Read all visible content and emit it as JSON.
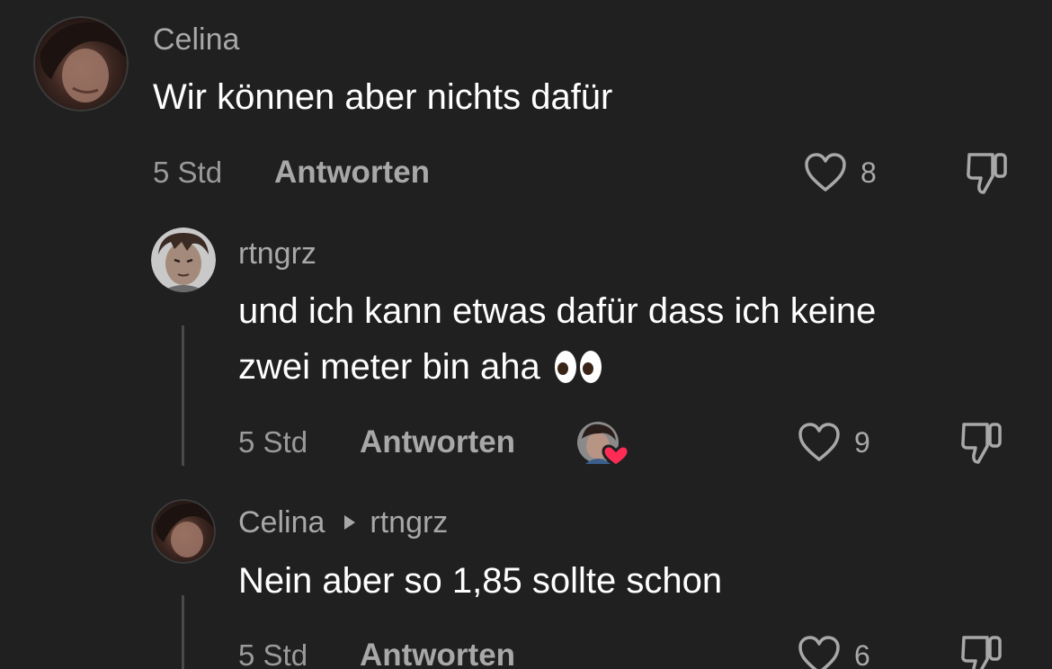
{
  "comments": [
    {
      "username": "Celina",
      "text": "Wir können aber nichts dafür",
      "time": "5 Std",
      "reply_label": "Antworten",
      "likes": "8"
    },
    {
      "username": "rtngrz",
      "text_line1": "und ich kann etwas dafür dass ich keine",
      "text_line2": "zwei meter bin aha",
      "emoji": "👀",
      "time": "5 Std",
      "reply_label": "Antworten",
      "likes": "9"
    },
    {
      "username": "Celina",
      "reply_to": "rtngrz",
      "text": "Nein aber so 1,85 sollte schon",
      "time": "5 Std",
      "reply_label": "Antworten",
      "likes": "6"
    }
  ],
  "icons": {
    "like": "heart-outline-icon",
    "dislike": "thumbs-down-icon",
    "creator_liked": "creator-liked-heart-icon",
    "reply_to": "triangle-right-icon"
  },
  "colors": {
    "background": "#202020",
    "text": "#ffffff",
    "muted": "#a8a8a8",
    "heart_badge": "#fe2c55"
  }
}
